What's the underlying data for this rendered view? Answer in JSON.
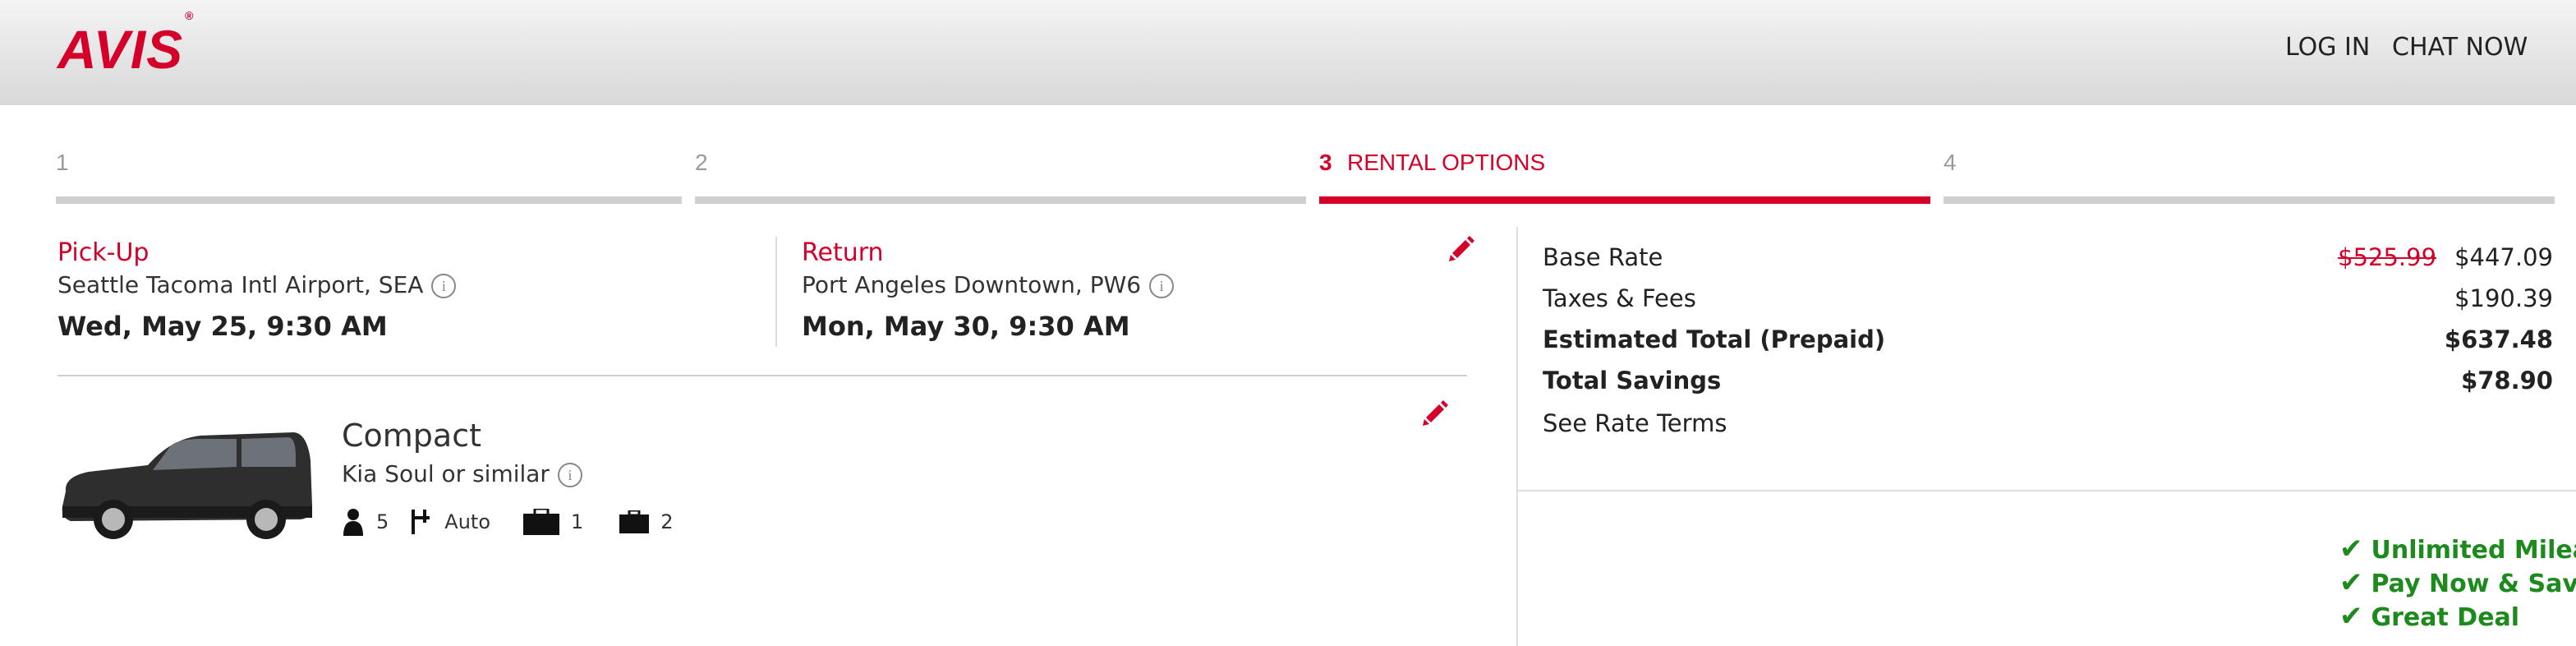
{
  "header": {
    "brand": "AVIS",
    "brand_mark": "®",
    "login": "LOG IN",
    "chat": "CHAT NOW"
  },
  "steps": [
    {
      "num": "1",
      "label": ""
    },
    {
      "num": "2",
      "label": ""
    },
    {
      "num": "3",
      "label": "RENTAL OPTIONS"
    },
    {
      "num": "4",
      "label": ""
    }
  ],
  "pickup": {
    "label": "Pick-Up",
    "location": "Seattle Tacoma Intl Airport, SEA",
    "datetime": "Wed, May 25, 9:30 AM"
  },
  "return": {
    "label": "Return",
    "location": "Port Angeles Downtown, PW6",
    "datetime": "Mon, May 30, 9:30 AM"
  },
  "car": {
    "class": "Compact",
    "model": "Kia Soul or similar",
    "passengers": "5",
    "transmission": "Auto",
    "large_bags": "1",
    "small_bags": "2"
  },
  "pricing": {
    "base_rate_label": "Base Rate",
    "base_rate_old": "$525.99",
    "base_rate": "$447.09",
    "taxes_label": "Taxes & Fees",
    "taxes": "$190.39",
    "total_label": "Estimated Total (Prepaid)",
    "total": "$637.48",
    "savings_label": "Total Savings",
    "savings": "$78.90",
    "terms_link": "See Rate Terms"
  },
  "features": [
    "Unlimited Mileage",
    "Pay Now & Save",
    "Great Deal"
  ],
  "colors": {
    "brand_red": "#d4002a",
    "feature_green": "#1d8a1d"
  }
}
